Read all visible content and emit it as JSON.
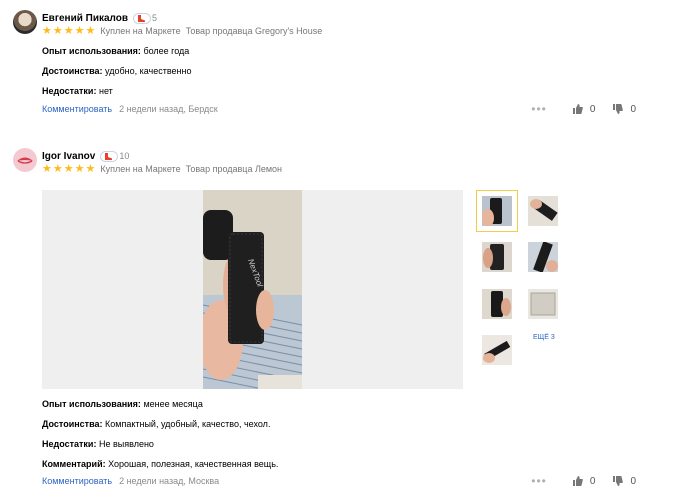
{
  "reviews": [
    {
      "author": "Евгений Пикалов",
      "badge_count": "5",
      "rating": 5,
      "purchase": "Куплен на Маркете",
      "seller": "Товар продавца Gregory's House",
      "fields": [
        {
          "label": "Опыт использования:",
          "value": "более года"
        },
        {
          "label": "Достоинства:",
          "value": "удобно, качественно"
        },
        {
          "label": "Недостатки:",
          "value": "нет"
        }
      ],
      "comment_label": "Комментировать",
      "date_location": "2 недели назад, Бердск",
      "likes": "0",
      "dislikes": "0"
    },
    {
      "author": "Igor Ivanov",
      "badge_count": "10",
      "rating": 5,
      "purchase": "Куплен на Маркете",
      "seller": "Товар продавца Лемон",
      "more_photos": "ЕЩЁ 3",
      "fields": [
        {
          "label": "Опыт использования:",
          "value": "менее месяца"
        },
        {
          "label": "Достоинства:",
          "value": "Компактный, удобный, качество, чехол."
        },
        {
          "label": "Недостатки:",
          "value": "Не выявлено"
        },
        {
          "label": "Комментарий:",
          "value": "Хорошая, полезная, качественная вещь."
        }
      ],
      "comment_label": "Комментировать",
      "date_location": "2 недели назад, Москва",
      "likes": "0",
      "dislikes": "0"
    }
  ],
  "photo_brand": "NexTool",
  "colors": {
    "star": "#fdbb1c",
    "link": "#2c64c6",
    "selected_thumb": "#f2cd4c"
  }
}
